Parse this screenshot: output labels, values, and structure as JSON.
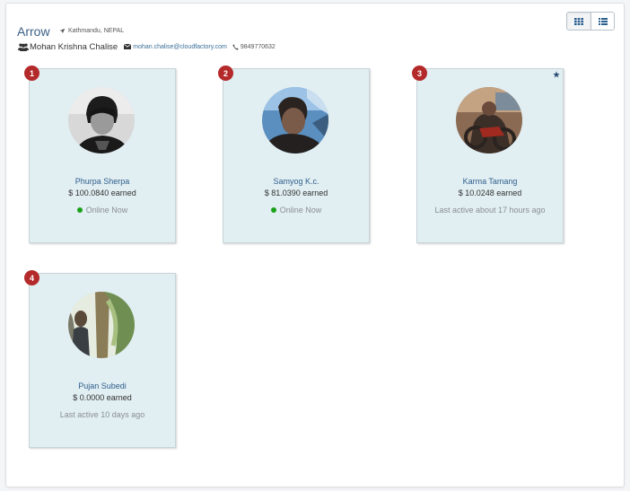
{
  "team": {
    "name": "Arrow",
    "location": "Kathmandu, NEPAL",
    "manager": "Mohan Krishna Chalise",
    "email": "mohan.chalise@cloudfactory.com",
    "phone": "9849770632"
  },
  "view_toggle": {
    "options": [
      {
        "icon": "grid-icon",
        "active": true
      },
      {
        "icon": "list-icon",
        "active": false
      }
    ]
  },
  "workers": [
    {
      "rank": "1",
      "name": "Phurpa Sherpa",
      "earned": "$ 100.0840 earned",
      "status": "Online Now",
      "online": true,
      "starred": false,
      "avatar": "avatar-photo-1"
    },
    {
      "rank": "2",
      "name": "Samyog K.c.",
      "earned": "$ 81.0390 earned",
      "status": "Online Now",
      "online": true,
      "starred": false,
      "avatar": "avatar-photo-2"
    },
    {
      "rank": "3",
      "name": "Karma Tamang",
      "earned": "$ 10.0248 earned",
      "status": "Last active about 17 hours ago",
      "online": false,
      "starred": true,
      "avatar": "avatar-photo-3"
    },
    {
      "rank": "4",
      "name": "Pujan Subedi",
      "earned": "$ 0.0000 earned",
      "status": "Last active 10 days ago",
      "online": false,
      "starred": false,
      "avatar": "avatar-photo-4"
    }
  ],
  "colors": {
    "card_bg": "#e1eef2",
    "rank_badge": "#b42a2a",
    "link": "#2f5f8c",
    "online_dot": "#1aa11a"
  }
}
